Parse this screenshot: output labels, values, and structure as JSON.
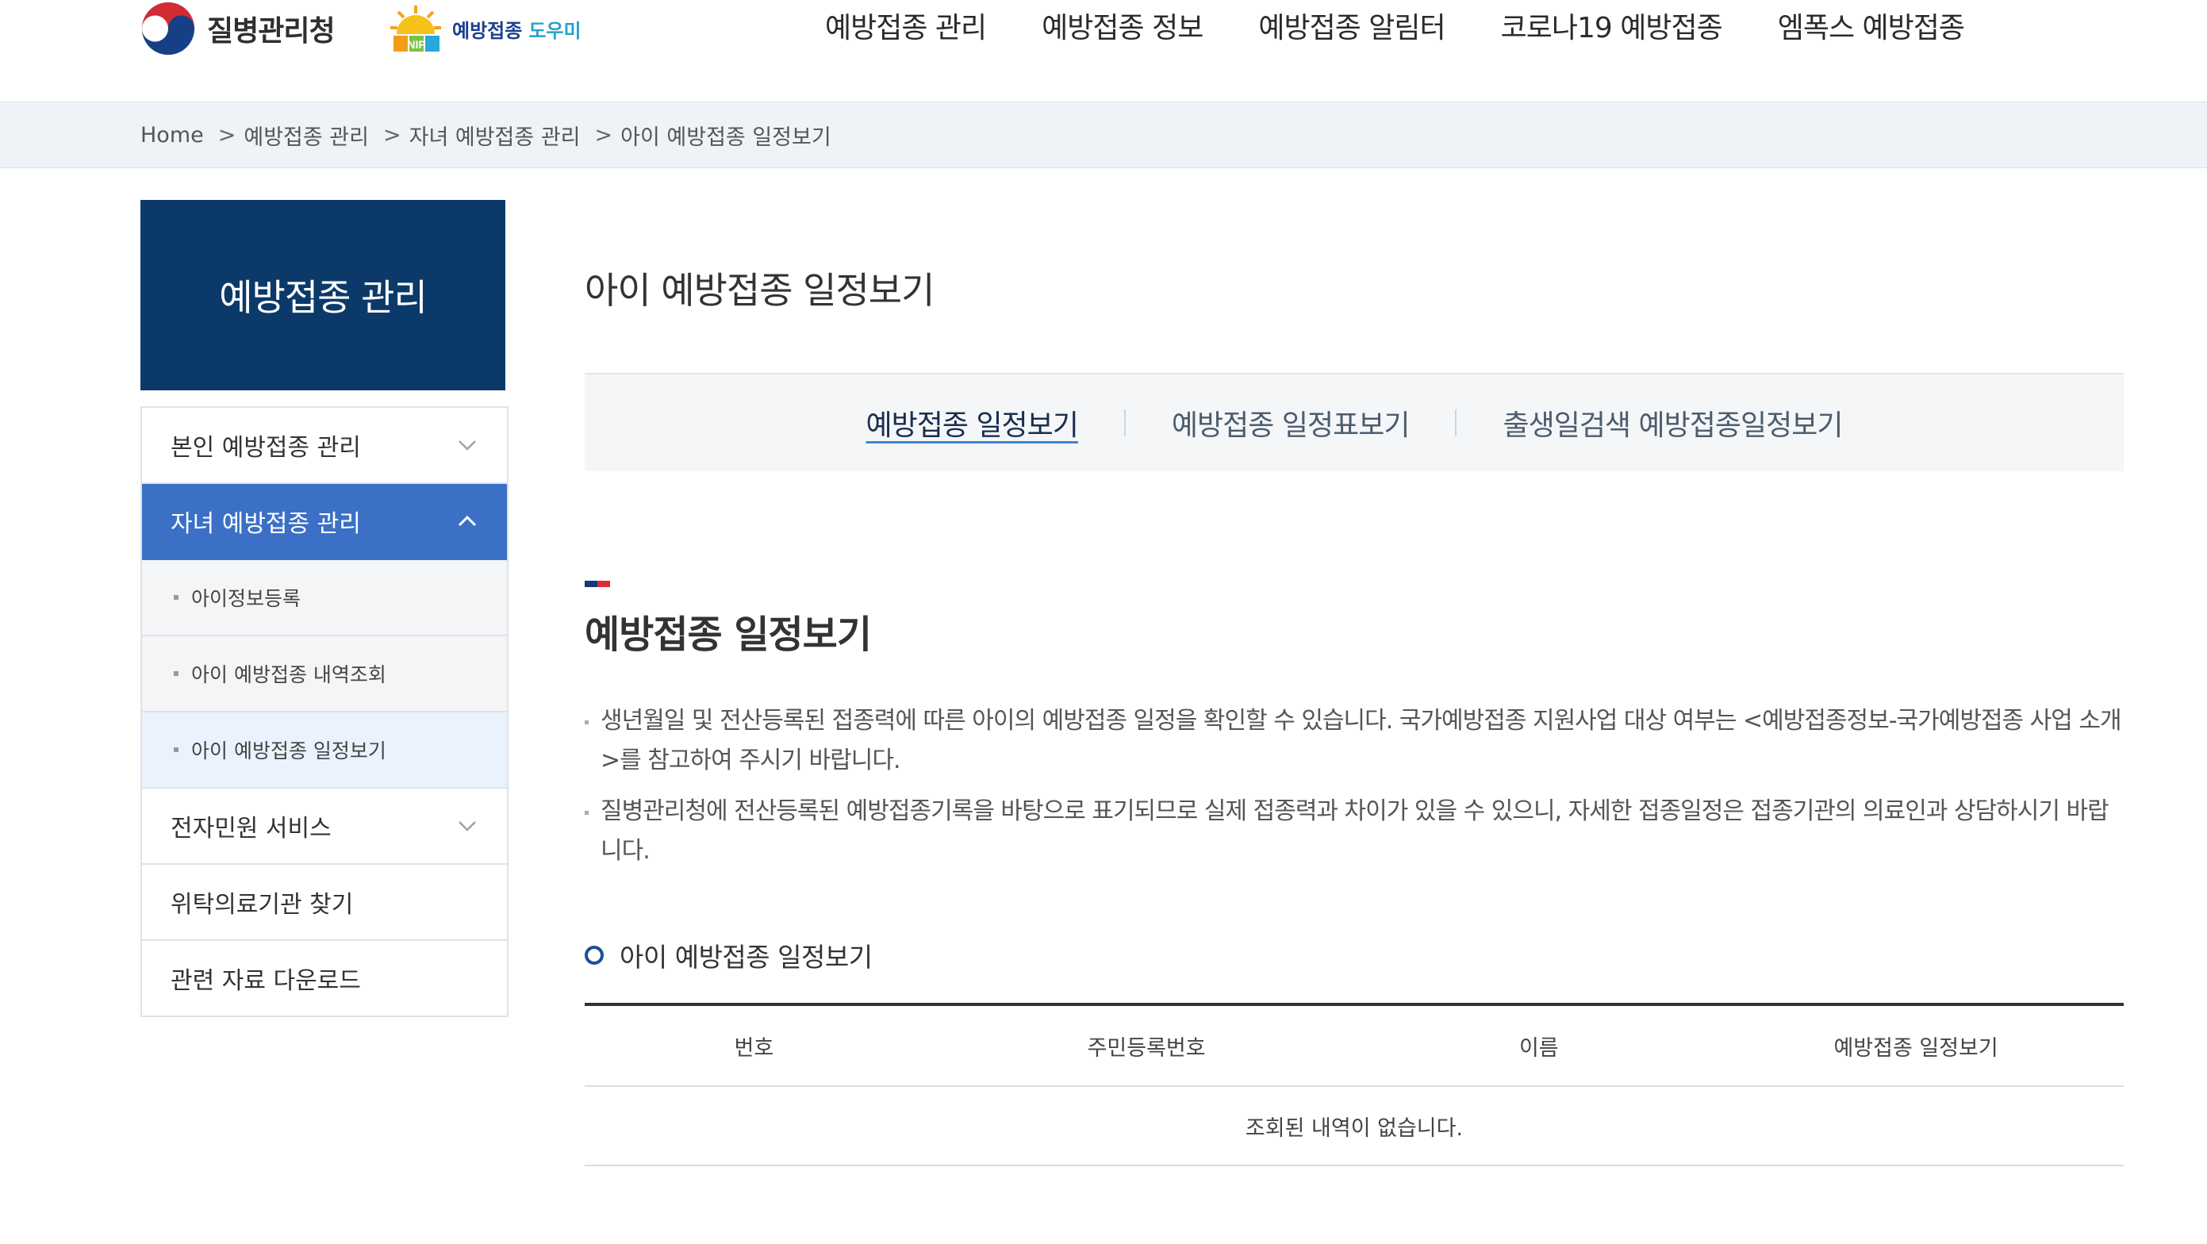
{
  "header": {
    "agency_name": "질병관리청",
    "nip_logo_text_a": "예방접종",
    "nip_logo_text_b": "도우미",
    "nip_logo_mark": "NIP",
    "nav": [
      "예방접종 관리",
      "예방접종 정보",
      "예방접종 알림터",
      "코로나19 예방접종",
      "엠폭스 예방접종"
    ]
  },
  "breadcrumb": {
    "home": "Home",
    "items": [
      "예방접종 관리",
      "자녀 예방접종 관리",
      "아이 예방접종 일정보기"
    ]
  },
  "sidebar": {
    "title": "예방접종 관리",
    "items": [
      {
        "label": "본인 예방접종 관리",
        "icon": "chevron-down-icon"
      },
      {
        "label": "자녀 예방접종 관리",
        "icon": "chevron-up-icon",
        "active": true,
        "children": [
          "아이정보등록",
          "아이 예방접종 내역조회",
          "아이 예방접종 일정보기"
        ]
      },
      {
        "label": "전자민원 서비스",
        "icon": "chevron-down-icon"
      },
      {
        "label": "위탁의료기관 찾기"
      },
      {
        "label": "관련 자료 다운로드"
      }
    ]
  },
  "main": {
    "page_title": "아이 예방접종 일정보기",
    "tabs": [
      "예방접종 일정보기",
      "예방접종 일정표보기",
      "출생일검색 예방접종일정보기"
    ],
    "section_title": "예방접종 일정보기",
    "notes": [
      "생년월일 및 전산등록된 접종력에 따른 아이의 예방접종 일정을 확인할 수 있습니다. 국가예방접종 지원사업 대상 여부는 <예방접종정보-국가예방접종 사업 소개>를 참고하여 주시기 바랍니다.",
      "질병관리청에 전산등록된 예방접종기록을 바탕으로 표기되므로 실제 접종력과 차이가 있을 수 있으니, 자세한 접종일정은 접종기관의 의료인과 상담하시기 바랍니다."
    ],
    "sub_title": "아이 예방접종 일정보기",
    "table": {
      "headers": [
        "번호",
        "주민등록번호",
        "이름",
        "예방접종 일정보기"
      ],
      "empty_message": "조회된 내역이 없습니다."
    }
  },
  "colors": {
    "sidebar_header": "#0b3a6a",
    "active_menu": "#3b70c6",
    "tab_underline": "#3e86d6",
    "mark_blue": "#12397a",
    "mark_red": "#e02a33"
  }
}
